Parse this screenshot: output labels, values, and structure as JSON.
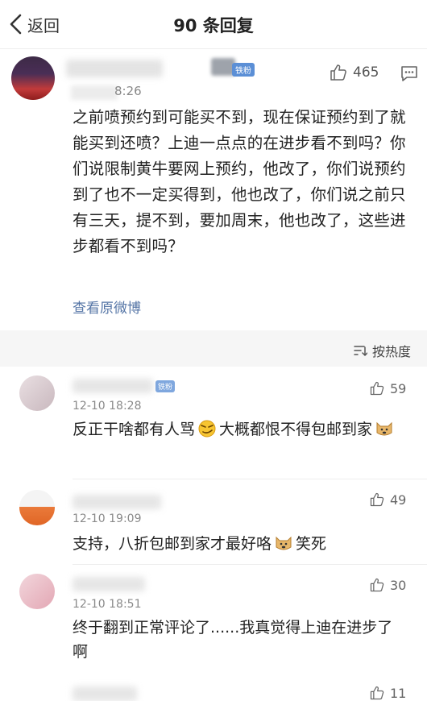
{
  "header": {
    "back_label": "返回",
    "title": "90 条回复"
  },
  "main_post": {
    "time": "8:26",
    "fan_badge": "铁粉",
    "likes": "465",
    "text": "之前喷预约到可能买不到，现在保证预约到了就能买到还喷？上迪一点点的在进步看不到吗？你们说限制黄牛要网上预约，他改了，你们说预约到了也不一定买得到，他也改了，你们说之前只有三天，提不到，要加周末，他也改了，这些进步都看不到吗？",
    "view_original": "查看原微博"
  },
  "sort": {
    "label": "按热度"
  },
  "comments": [
    {
      "time": "12-10 18:28",
      "fan_badge": "铁粉",
      "likes": "59",
      "text_a": "反正干啥都有人骂",
      "text_b": "大概都恨不得包邮到家"
    },
    {
      "time": "12-10 19:09",
      "likes": "49",
      "text_a": "支持，八折包邮到家才最好咯",
      "text_b": "笑死"
    },
    {
      "time": "12-10 18:51",
      "likes": "30",
      "text_a": "终于翻到正常评论了......我真觉得上迪在进步了啊"
    }
  ],
  "partial_comment": {
    "likes": "11"
  },
  "colors": {
    "link": "#5575a6",
    "fan_badge": "#5b8fd6",
    "sort_bar": "#f6f6f6"
  }
}
